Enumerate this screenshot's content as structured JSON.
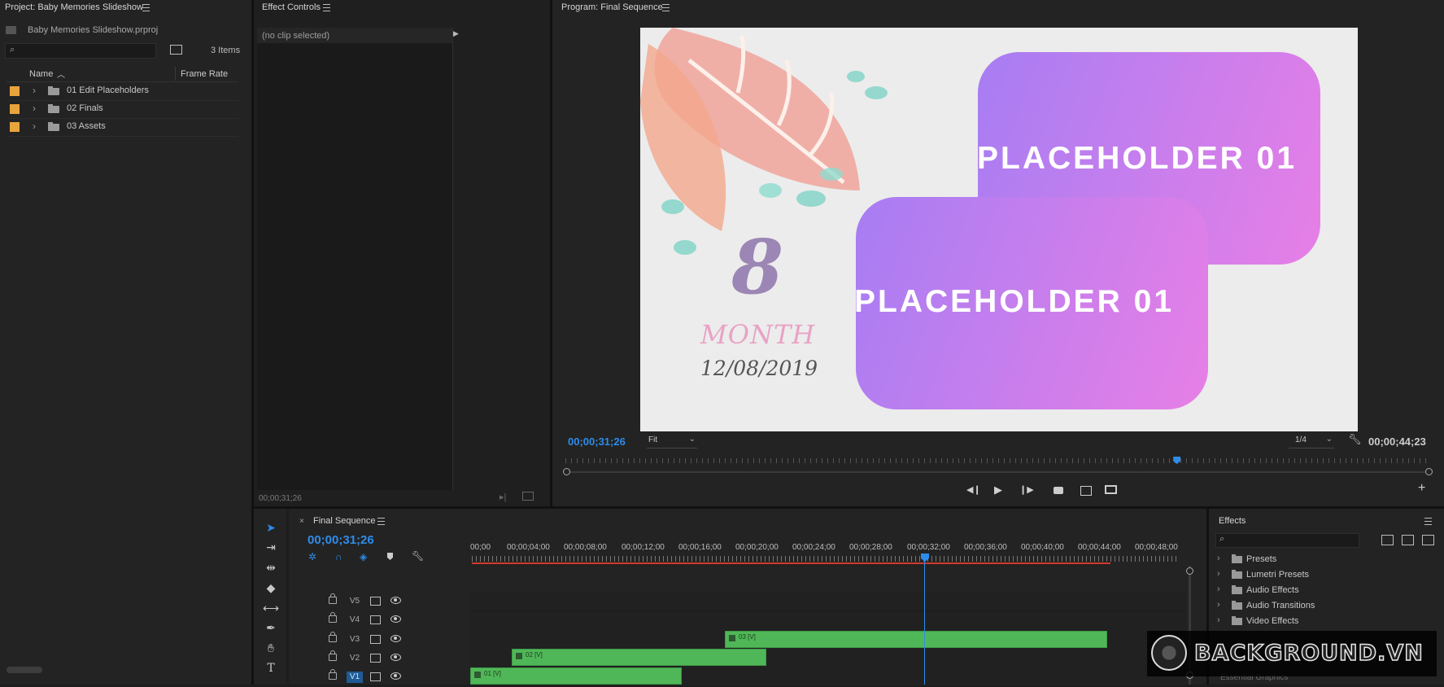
{
  "project_panel": {
    "title": "Project: Baby Memories Slideshow",
    "file_name": "Baby Memories Slideshow.prproj",
    "item_count": "3 Items",
    "search_placeholder": "",
    "col_name": "Name",
    "col_frame_rate": "Frame Rate",
    "items": [
      {
        "label": "01 Edit Placeholders",
        "color": "#e8a33d"
      },
      {
        "label": "02 Finals",
        "color": "#e8a33d"
      },
      {
        "label": "03 Assets",
        "color": "#e8a33d"
      }
    ]
  },
  "effect_controls": {
    "title": "Effect Controls",
    "clip_status": "(no clip selected)",
    "timecode": "00;00;31;26"
  },
  "program_monitor": {
    "title": "Program: Final Sequence",
    "timecode_current": "00;00;31;26",
    "zoom": "Fit",
    "resolution": "1/4",
    "timecode_duration": "00;00;44;23",
    "playhead_fraction": 0.71,
    "frame": {
      "placeholder_top": "PLACEHOLDER 01",
      "placeholder_bottom": "PLACEHOLDER 01",
      "number": "8",
      "month": "MONTH",
      "date": "12/08/2019"
    }
  },
  "timeline": {
    "title": "Final Sequence",
    "timecode": "00;00;31;26",
    "ruler": [
      "00;00",
      "00;00;04;00",
      "00;00;08;00",
      "00;00;12;00",
      "00;00;16;00",
      "00;00;20;00",
      "00;00;24;00",
      "00;00;28;00",
      "00;00;32;00",
      "00;00;36;00",
      "00;00;40;00",
      "00;00;44;00",
      "00;00;48;00"
    ],
    "tracks": [
      {
        "name": "V5"
      },
      {
        "name": "V4"
      },
      {
        "name": "V3"
      },
      {
        "name": "V2"
      },
      {
        "name": "V1"
      }
    ],
    "clips": [
      {
        "label": "03 [V]",
        "track": "V3"
      },
      {
        "label": "02 [V]",
        "track": "V2"
      },
      {
        "label": "01 [V]",
        "track": "V1"
      }
    ]
  },
  "effects_panel": {
    "title": "Effects",
    "search_placeholder": "",
    "items": [
      {
        "label": "Presets"
      },
      {
        "label": "Lumetri Presets"
      },
      {
        "label": "Audio Effects"
      },
      {
        "label": "Audio Transitions"
      },
      {
        "label": "Video Effects"
      }
    ],
    "cut_off_item": "Essential Graphics"
  },
  "watermark": {
    "text": "BACKGROUND.VN"
  },
  "colors": {
    "accent_blue": "#2d8ceb",
    "clip_green": "#4fb757",
    "label_orange": "#e8a33d",
    "playhead_red": "#d03a2c"
  }
}
